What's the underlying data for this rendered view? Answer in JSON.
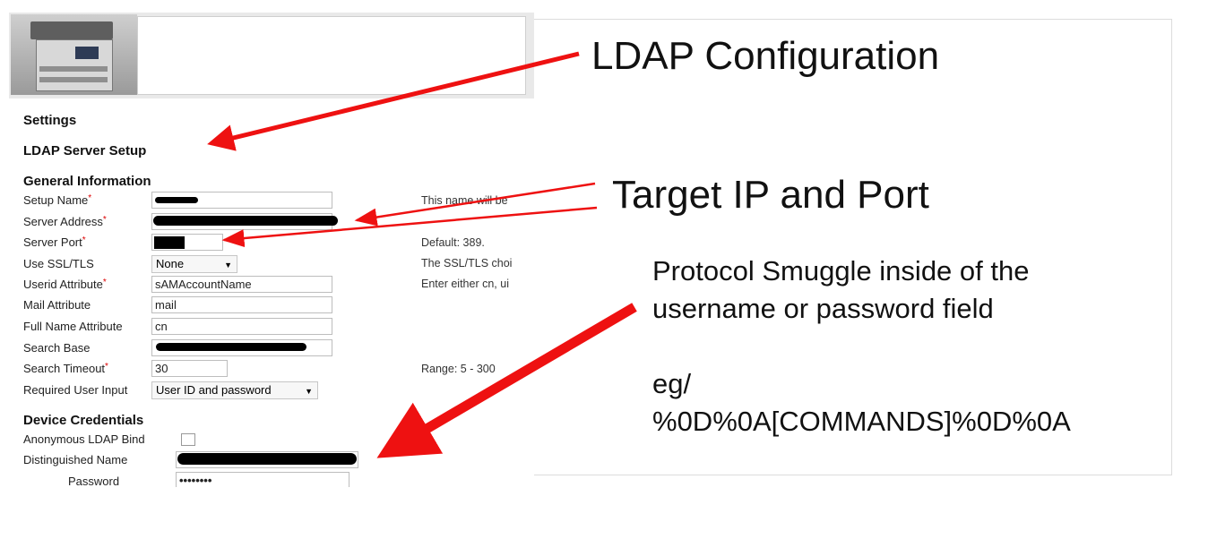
{
  "annotations": {
    "ldap_config": "LDAP Configuration",
    "target_ip_port": "Target IP and Port",
    "smuggle_line1": "Protocol Smuggle inside of the",
    "smuggle_line2": "username or password field",
    "eg": "eg/",
    "payload": "%0D%0A[COMMANDS]%0D%0A"
  },
  "settings": {
    "heading": "Settings",
    "server_setup": "LDAP Server Setup",
    "general_info": "General Information",
    "fields": {
      "setup_name": {
        "label": "Setup Name",
        "required": "*",
        "note": "This name will be"
      },
      "server_address": {
        "label": "Server Address",
        "required": "*"
      },
      "server_port": {
        "label": "Server Port",
        "required": "*",
        "note": "Default: 389."
      },
      "use_ssl": {
        "label": "Use SSL/TLS",
        "value": "None",
        "note": "The SSL/TLS choi"
      },
      "userid_attr": {
        "label": "Userid Attribute",
        "required": "*",
        "value": "sAMAccountName",
        "note": "Enter either cn, ui"
      },
      "mail_attr": {
        "label": "Mail Attribute",
        "value": "mail"
      },
      "fullname_attr": {
        "label": "Full Name Attribute",
        "value": "cn"
      },
      "search_base": {
        "label": "Search Base"
      },
      "search_timeout": {
        "label": "Search Timeout",
        "required": "*",
        "value": "30",
        "note": "Range: 5 - 300"
      },
      "required_input": {
        "label": "Required User Input",
        "value": "User ID and password"
      }
    },
    "device_credentials": "Device Credentials",
    "anon_bind": "Anonymous LDAP Bind",
    "distinguished_name": "Distinguished Name",
    "password_label": "Password",
    "password_value": "••••••••"
  },
  "colors": {
    "arrow": "#ee1111",
    "required": "#dd0000"
  },
  "icons": {
    "caret": "caret-down-icon",
    "printer": "printer-image"
  }
}
